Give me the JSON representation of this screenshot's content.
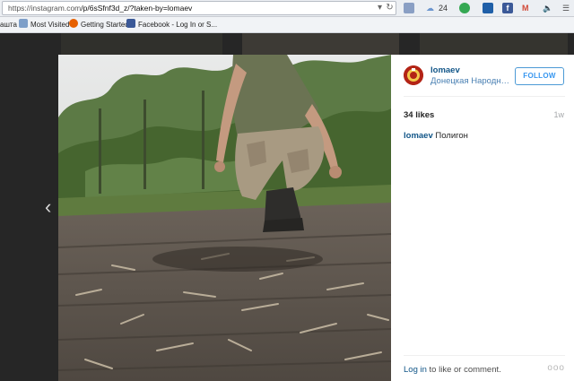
{
  "browser": {
    "url_host": "https://instagram.com",
    "url_path": "/p/6sSfnf3d_z/?taken-by=lomaev",
    "weather_temp": "24",
    "bookmarks": [
      {
        "label": "ашта"
      },
      {
        "label": "Most Visited"
      },
      {
        "label": "Getting Started"
      },
      {
        "label": "Facebook - Log In or S..."
      }
    ]
  },
  "post": {
    "username": "lomaev",
    "location": "Донецкая Народная Республика",
    "follow_label": "FOLLOW",
    "likes": "34 likes",
    "age": "1w",
    "caption_user": "lomaev",
    "caption_text": "Полигон",
    "login_link": "Log in",
    "login_rest": " to like or comment.",
    "more_label": "ooo"
  },
  "colors": {
    "link": "#125688",
    "follow": "#3897f0",
    "page_bg": "#262626"
  }
}
